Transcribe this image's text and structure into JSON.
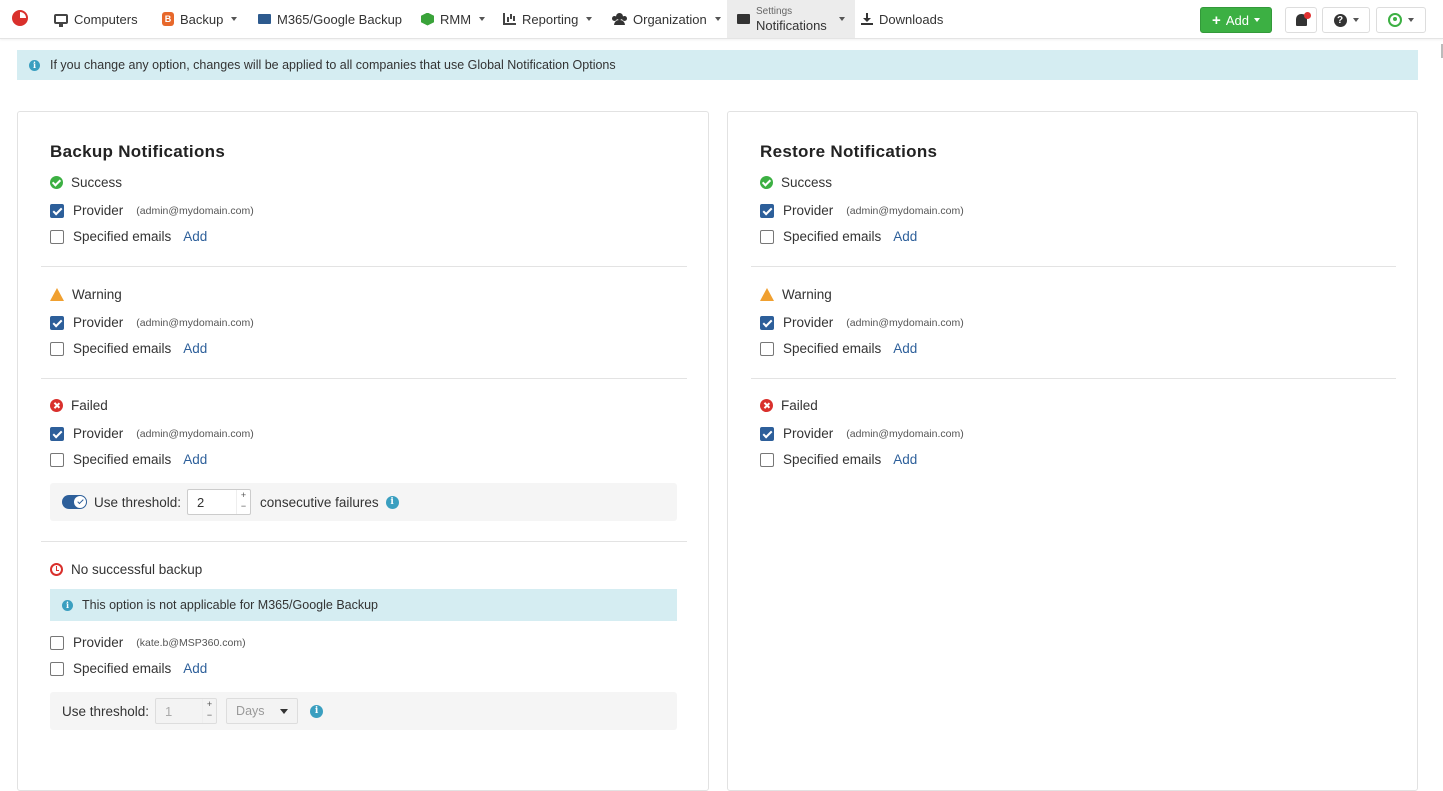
{
  "nav": {
    "items": [
      {
        "label": "Computers"
      },
      {
        "label": "Backup"
      },
      {
        "label": "M365/Google Backup"
      },
      {
        "label": "RMM"
      },
      {
        "label": "Reporting"
      },
      {
        "label": "Organization"
      },
      {
        "label_small": "Settings",
        "label": "Notifications"
      },
      {
        "label": "Downloads"
      }
    ],
    "add_label": "Add",
    "backup_icon_letter": "B"
  },
  "alert": {
    "text": "If you change any option, changes will be applied to all companies that use Global Notification Options"
  },
  "backup": {
    "title": "Backup Notifications",
    "success": {
      "label": "Success",
      "provider": "Provider",
      "provider_checked": true,
      "email": "(admin@mydomain.com)",
      "specified": "Specified emails",
      "add": "Add"
    },
    "warning": {
      "label": "Warning",
      "provider": "Provider",
      "provider_checked": true,
      "email": "(admin@mydomain.com)",
      "specified": "Specified emails",
      "add": "Add"
    },
    "failed": {
      "label": "Failed",
      "provider": "Provider",
      "provider_checked": true,
      "email": "(admin@mydomain.com)",
      "specified": "Specified emails",
      "add": "Add",
      "threshold_label": "Use threshold:",
      "threshold_value": "2",
      "threshold_suffix": "consecutive failures",
      "threshold_enabled": true
    },
    "no_success": {
      "label": "No successful backup",
      "note": "This option is not applicable for M365/Google Backup",
      "provider": "Provider",
      "provider_checked": false,
      "email": "(kate.b@MSP360.com)",
      "specified": "Specified emails",
      "add": "Add",
      "threshold_label": "Use threshold:",
      "threshold_value": "1",
      "unit": "Days"
    }
  },
  "restore": {
    "title": "Restore Notifications",
    "success": {
      "label": "Success",
      "provider": "Provider",
      "provider_checked": true,
      "email": "(admin@mydomain.com)",
      "specified": "Specified emails",
      "add": "Add"
    },
    "warning": {
      "label": "Warning",
      "provider": "Provider",
      "provider_checked": true,
      "email": "(admin@mydomain.com)",
      "specified": "Specified emails",
      "add": "Add"
    },
    "failed": {
      "label": "Failed",
      "provider": "Provider",
      "provider_checked": true,
      "email": "(admin@mydomain.com)",
      "specified": "Specified emails",
      "add": "Add"
    }
  },
  "colors": {
    "accent": "#2d5f9a",
    "add_button": "#3cb043",
    "info_bg": "#d5edf2",
    "success": "#3cb043",
    "warning": "#f0a030",
    "failed": "#d9302c"
  }
}
